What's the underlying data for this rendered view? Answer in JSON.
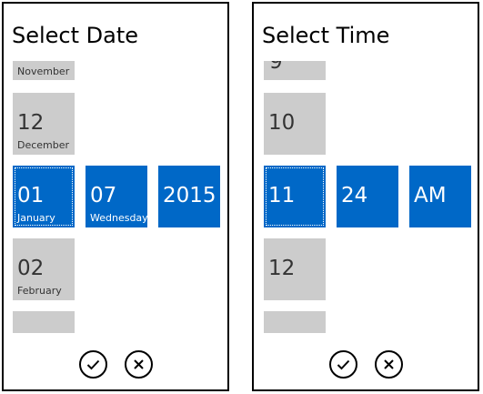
{
  "date_picker": {
    "title": "Select Date",
    "above_label": "November",
    "prev": {
      "value": "12",
      "label": "December"
    },
    "selected": {
      "month": {
        "value": "01",
        "label": "January"
      },
      "day": {
        "value": "07",
        "label": "Wednesday"
      },
      "year": {
        "value": "2015"
      }
    },
    "next": {
      "value": "02",
      "label": "February"
    },
    "accept_icon": "checkmark-icon",
    "cancel_icon": "close-icon"
  },
  "time_picker": {
    "title": "Select Time",
    "prev": {
      "value": "10"
    },
    "selected": {
      "hour": {
        "value": "11"
      },
      "minute": {
        "value": "24"
      },
      "period": {
        "value": "AM"
      }
    },
    "next": {
      "value": "12"
    },
    "accept_icon": "checkmark-icon",
    "cancel_icon": "close-icon"
  },
  "colors": {
    "accent": "#0068c7",
    "tile_gray": "#cccccc",
    "border": "#000000"
  }
}
